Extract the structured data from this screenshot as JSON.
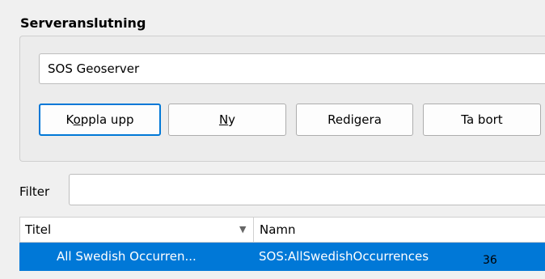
{
  "group": {
    "title": "Serveranslutning"
  },
  "connection": {
    "selected": "SOS Geoserver"
  },
  "buttons": {
    "connect": {
      "pre": "K",
      "accel": "o",
      "post": "ppla upp"
    },
    "new": {
      "pre": "",
      "accel": "N",
      "post": "y"
    },
    "edit": {
      "label": "Redigera"
    },
    "delete": {
      "label": "Ta bort"
    }
  },
  "filter": {
    "label": "Filter",
    "value": ""
  },
  "table": {
    "columns": [
      "Titel",
      "Namn"
    ],
    "rows": [
      {
        "title": "All Swedish Occurren...",
        "name": "SOS:AllSwedishOccurrences",
        "count": "36"
      }
    ]
  },
  "colors": {
    "selection": "#0078d7",
    "focus_border": "#0078d7"
  }
}
